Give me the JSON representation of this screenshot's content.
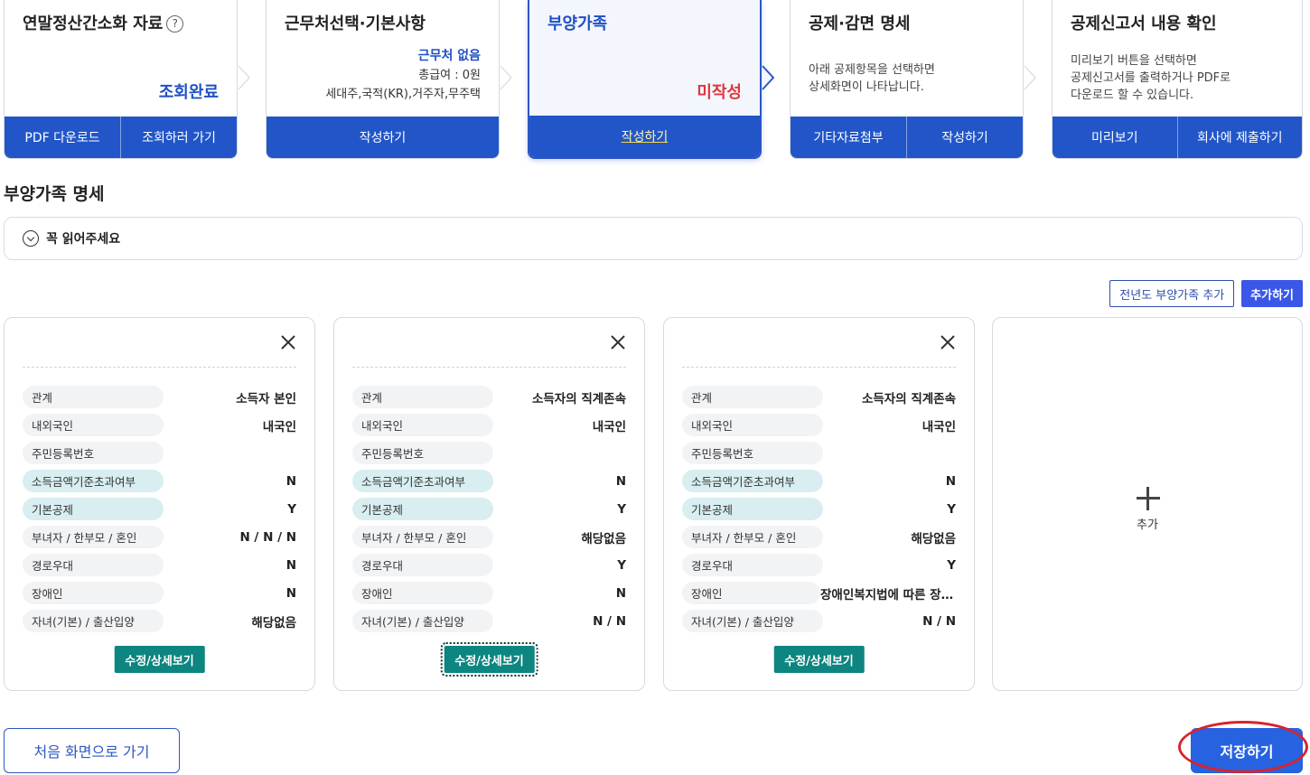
{
  "steps": [
    {
      "title": "연말정산간소화 자료",
      "status": "조회완료",
      "buttons": [
        "PDF 다운로드",
        "조회하러 가기"
      ]
    },
    {
      "title": "근무처선택·기본사항",
      "info_highlight": "근무처 없음",
      "info_line1": "총급여 : 0원",
      "info_line2": "세대주,국적(KR),거주자,무주택",
      "buttons": [
        "작성하기"
      ]
    },
    {
      "title": "부양가족",
      "status": "미작성",
      "buttons": [
        "작성하기"
      ]
    },
    {
      "title": "공제·감면 명세",
      "desc_line1": "아래 공제항목을 선택하면",
      "desc_line2": "상세화면이 나타납니다.",
      "buttons": [
        "기타자료첨부",
        "작성하기"
      ]
    },
    {
      "title": "공제신고서 내용 확인",
      "desc_line1": "미리보기 버튼을 선택하면",
      "desc_line2": "공제신고서를 출력하거나 PDF로",
      "desc_line3": "다운로드 할 수 있습니다.",
      "buttons": [
        "미리보기",
        "회사에 제출하기"
      ]
    }
  ],
  "section_title": "부양가족 명세",
  "notice_label": "꼭 읽어주세요",
  "actions": {
    "prev_year_label": "전년도 부양가족 추가",
    "add_label": "추가하기"
  },
  "labels": {
    "relation": "관계",
    "nationality": "내외국인",
    "rrn": "주민등록번호",
    "income_over": "소득금액기준초과여부",
    "basic": "기본공제",
    "woman_single_marriage": "부녀자 / 한부모 / 혼인",
    "elder": "경로우대",
    "disabled": "장애인",
    "child_birth": "자녀(기본) / 출산입양"
  },
  "dependents": [
    {
      "relation": "소득자 본인",
      "nationality": "내국인",
      "rrn": "",
      "income_over": "N",
      "basic": "Y",
      "woman_single_marriage": "N / N / N",
      "elder": "N",
      "disabled": "N",
      "child_birth": "해당없음"
    },
    {
      "relation": "소득자의 직계존속",
      "nationality": "내국인",
      "rrn": "",
      "income_over": "N",
      "basic": "Y",
      "woman_single_marriage": "해당없음",
      "elder": "Y",
      "disabled": "N",
      "child_birth": "N / N"
    },
    {
      "relation": "소득자의 직계존속",
      "nationality": "내국인",
      "rrn": "",
      "income_over": "N",
      "basic": "Y",
      "woman_single_marriage": "해당없음",
      "elder": "Y",
      "disabled": "장애인복지법에 따른 장애인",
      "child_birth": "N / N"
    }
  ],
  "detail_button_label": "수정/상세보기",
  "add_card_label": "추가",
  "footer": {
    "home_label": "처음 화면으로 가기",
    "save_label": "저장하기"
  },
  "colors": {
    "primary": "#2256c8",
    "teal": "#0d8580",
    "red": "#e2343c",
    "accent": "#3a57e8"
  }
}
